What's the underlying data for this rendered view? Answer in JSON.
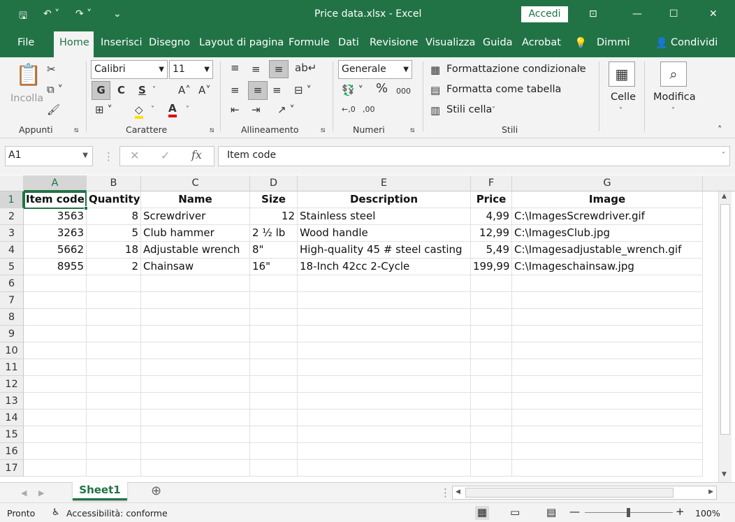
{
  "titlebar": {
    "title": "Price data.xlsx  -  Excel",
    "accedi": "Accedi"
  },
  "tabs": [
    "File",
    "Home",
    "Inserisci",
    "Disegno",
    "Layout di pagina",
    "Formule",
    "Dati",
    "Revisione",
    "Visualizza",
    "Guida",
    "Acrobat",
    "Dimmi",
    "Condividi"
  ],
  "ribbon": {
    "paste": "Incolla",
    "font": "Calibri",
    "size": "11",
    "bold": "G",
    "italic": "C",
    "underline": "S",
    "numfmt": "Generale",
    "cond": "Formattazione condizionale",
    "table": "Formatta come tabella",
    "styles": "Stili cella",
    "cells": "Celle",
    "edit": "Modifica",
    "groups": {
      "appunti": "Appunti",
      "carattere": "Carattere",
      "allineamento": "Allineamento",
      "numeri": "Numeri",
      "stili": "Stili"
    }
  },
  "formula": {
    "namebox": "A1",
    "content": "Item code"
  },
  "columns": [
    "A",
    "B",
    "C",
    "D",
    "E",
    "F",
    "G"
  ],
  "rows": [
    "1",
    "2",
    "3",
    "4",
    "5",
    "6",
    "7",
    "8",
    "9",
    "10",
    "11",
    "12",
    "13",
    "14",
    "15",
    "16",
    "17"
  ],
  "table": {
    "headers": [
      "Item code",
      "Quantity",
      "Name",
      "Size",
      "Description",
      "Price",
      "Image"
    ],
    "data": [
      [
        "3563",
        "8",
        "Screwdriver",
        "12",
        "Stainless steel",
        "4,99",
        "C:\\ImagesScrewdriver.gif"
      ],
      [
        "3263",
        "5",
        "Club hammer",
        "2 ½ lb",
        "Wood handle",
        "12,99",
        "C:\\ImagesClub.jpg"
      ],
      [
        "5662",
        "18",
        "Adjustable wrench",
        "8\"",
        "High-quality 45 # steel casting",
        "5,49",
        "C:\\Imagesadjustable_wrench.gif"
      ],
      [
        "8955",
        "2",
        "Chainsaw",
        "16\"",
        "18-Inch 42cc 2-Cycle",
        "199,99",
        "C:\\Imageschainsaw.jpg"
      ]
    ]
  },
  "sheet": {
    "name": "Sheet1"
  },
  "status": {
    "ready": "Pronto",
    "access": "Accessibilità: conforme",
    "zoom": "100%"
  }
}
